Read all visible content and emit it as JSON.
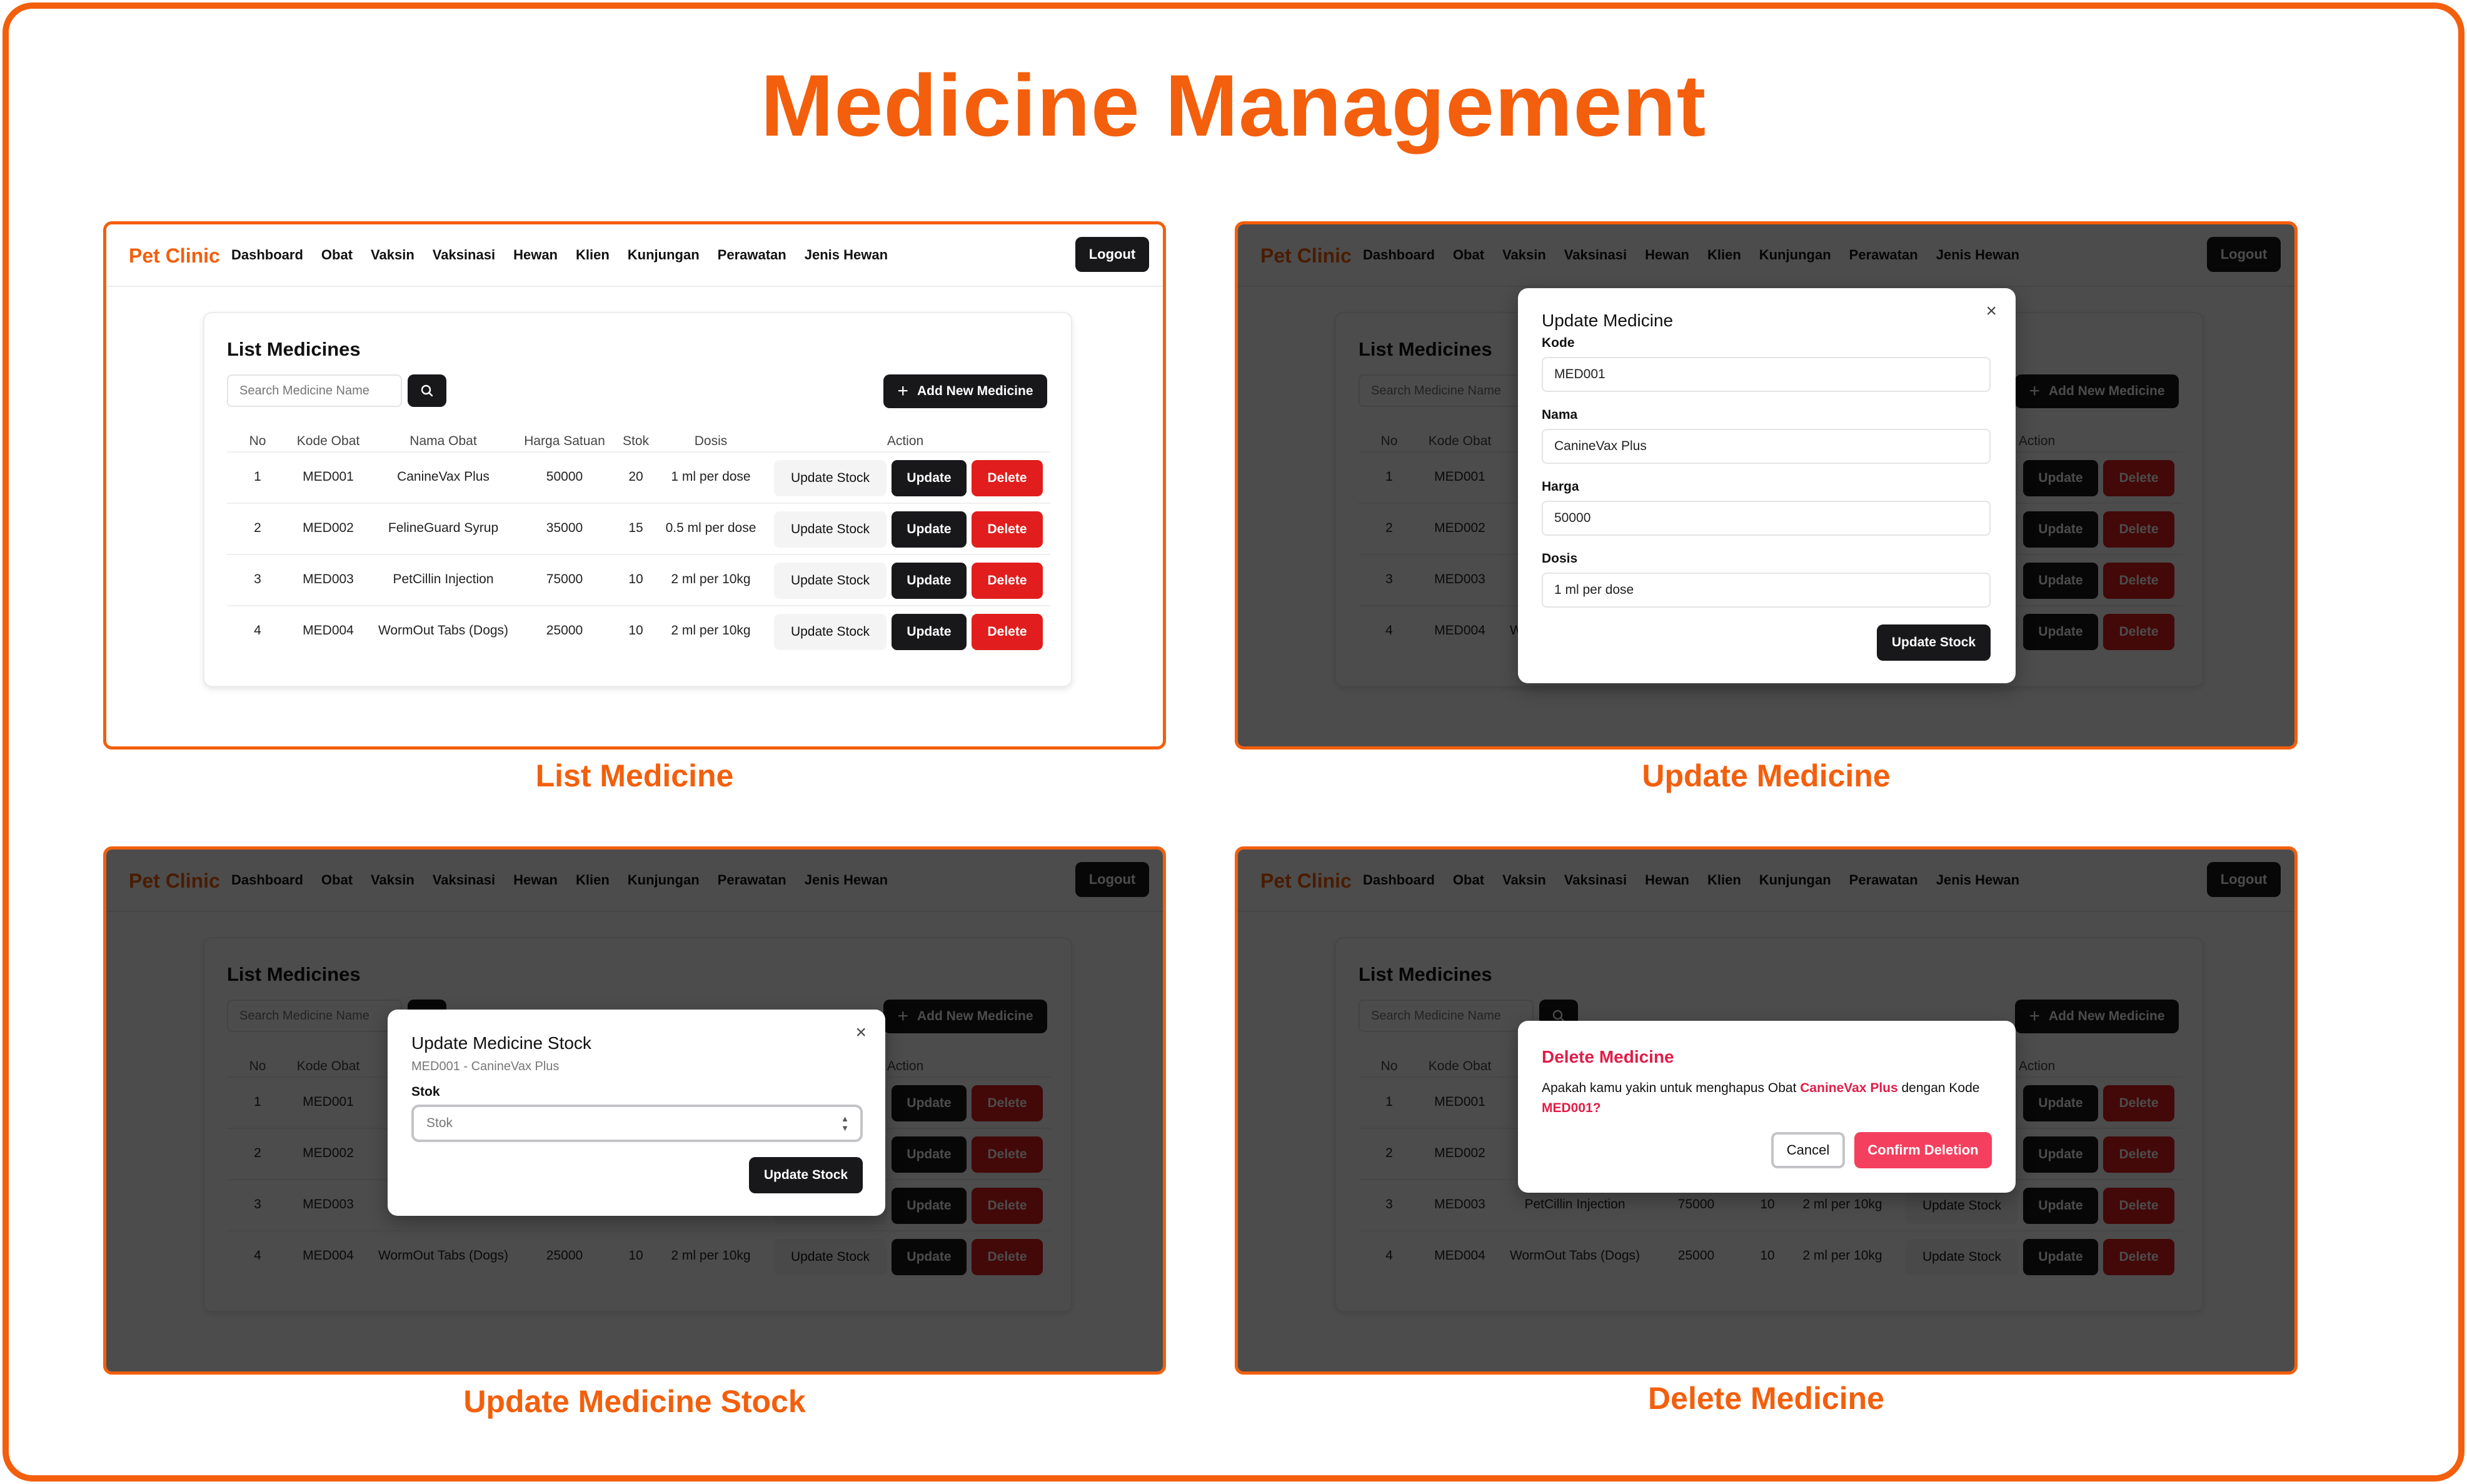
{
  "page_title": "Medicine Management",
  "captions": [
    "List Medicine",
    "Update Medicine",
    "Update Medicine Stock",
    "Delete Medicine"
  ],
  "app": {
    "brand": "Pet Clinic",
    "nav": [
      "Dashboard",
      "Obat",
      "Vaksin",
      "Vaksinasi",
      "Hewan",
      "Klien",
      "Kunjungan",
      "Perawatan",
      "Jenis Hewan"
    ],
    "logout_label": "Logout"
  },
  "list": {
    "title": "List Medicines",
    "search_placeholder": "Search Medicine Name",
    "add_label": "Add New Medicine",
    "columns": [
      "No",
      "Kode Obat",
      "Nama Obat",
      "Harga Satuan",
      "Stok",
      "Dosis",
      "Action"
    ],
    "rows": [
      {
        "no": "1",
        "kode": "MED001",
        "nama": "CanineVax Plus",
        "harga": "50000",
        "stok": "20",
        "dosis": "1 ml per dose"
      },
      {
        "no": "2",
        "kode": "MED002",
        "nama": "FelineGuard Syrup",
        "harga": "35000",
        "stok": "15",
        "dosis": "0.5 ml per dose"
      },
      {
        "no": "3",
        "kode": "MED003",
        "nama": "PetCillin Injection",
        "harga": "75000",
        "stok": "10",
        "dosis": "2 ml per 10kg"
      },
      {
        "no": "4",
        "kode": "MED004",
        "nama": "WormOut Tabs (Dogs)",
        "harga": "25000",
        "stok": "10",
        "dosis": "2 ml per 10kg"
      }
    ],
    "update_stock_label": "Update Stock",
    "update_label": "Update",
    "delete_label": "Delete"
  },
  "update_modal": {
    "title": "Update Medicine",
    "close": "×",
    "fields": [
      {
        "label": "Kode",
        "value": "MED001"
      },
      {
        "label": "Nama",
        "value": "CanineVax Plus"
      },
      {
        "label": "Harga",
        "value": "50000"
      },
      {
        "label": "Dosis",
        "value": "1 ml per dose"
      }
    ],
    "submit_label": "Update Stock"
  },
  "stock_modal": {
    "title": "Update Medicine Stock",
    "subtitle": "MED001 - CanineVax Plus",
    "close": "×",
    "field_label": "Stok",
    "field_placeholder": "Stok",
    "submit_label": "Update Stock"
  },
  "delete_modal": {
    "title": "Delete Medicine",
    "msg_prefix": "Apakah kamu yakin untuk menghapus Obat ",
    "msg_name": "CanineVax Plus",
    "msg_mid": " dengan Kode ",
    "msg_code": "MED001",
    "msg_suffix": "?",
    "cancel_label": "Cancel",
    "confirm_label": "Confirm Deletion"
  }
}
